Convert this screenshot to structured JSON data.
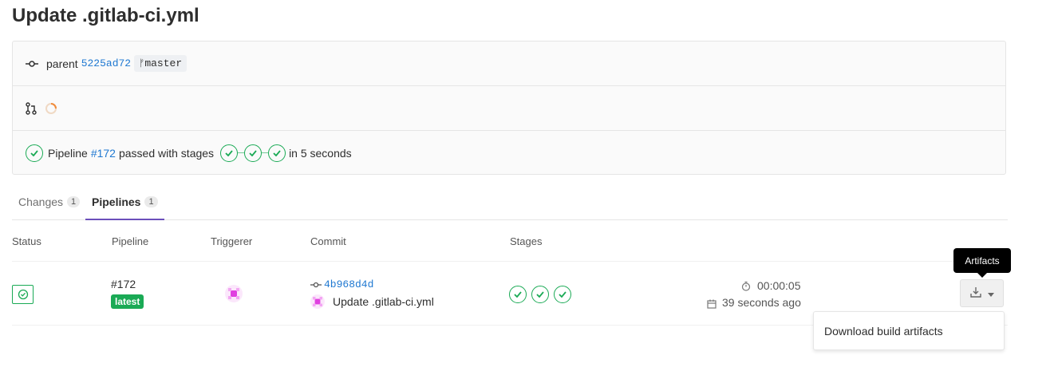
{
  "page": {
    "title": "Update .gitlab-ci.yml"
  },
  "commit_info": {
    "parent_label": "parent",
    "parent_sha": "5225ad72",
    "branch_icon": "branch-icon",
    "branch": "master",
    "mr_icon": "merge-request-icon",
    "loading_icon": "spinner-icon"
  },
  "pipeline_summary": {
    "prefix": "Pipeline",
    "id": "#172",
    "status_text": "passed with stages",
    "suffix": "in 5 seconds"
  },
  "tabs": [
    {
      "label": "Changes",
      "count": "1"
    },
    {
      "label": "Pipelines",
      "count": "1"
    }
  ],
  "table": {
    "headers": [
      "Status",
      "Pipeline",
      "Triggerer",
      "Commit",
      "Stages"
    ],
    "rows": [
      {
        "pipeline_id": "#172",
        "badge": "latest",
        "commit_sha": "4b968d4d",
        "commit_title": "Update .gitlab-ci.yml",
        "duration": "00:00:05",
        "finished": "39 seconds ago"
      }
    ]
  },
  "artifacts": {
    "tooltip": "Artifacts",
    "menu_item": "Download build artifacts"
  },
  "colors": {
    "success": "#1aaa55",
    "link": "#1f78d1",
    "accent_tab": "#6b4fbb"
  }
}
